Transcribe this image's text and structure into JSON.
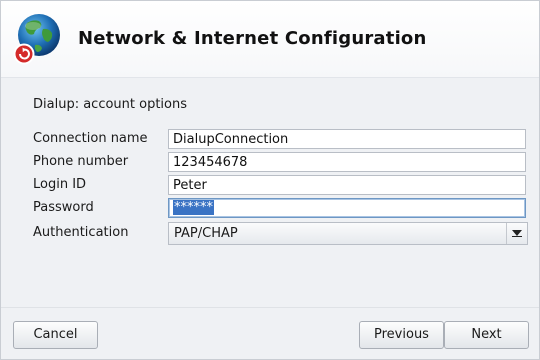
{
  "window": {
    "title": "Network & Internet Configuration",
    "app_icon": "globe-network-icon"
  },
  "form": {
    "section_label": "Dialup: account options",
    "connection_name": {
      "label": "Connection name",
      "value": "DialupConnection"
    },
    "phone_number": {
      "label": "Phone number",
      "value": "123454678"
    },
    "login_id": {
      "label": "Login ID",
      "value": "Peter"
    },
    "password": {
      "label": "Password",
      "value": "******"
    },
    "authentication": {
      "label": "Authentication",
      "value": "PAP/CHAP",
      "icon": "chevron-down-icon"
    }
  },
  "buttons": {
    "cancel": "Cancel",
    "previous": "Previous",
    "next": "Next"
  },
  "colors": {
    "selection": "#3a73c4",
    "background": "#eff1f4"
  }
}
